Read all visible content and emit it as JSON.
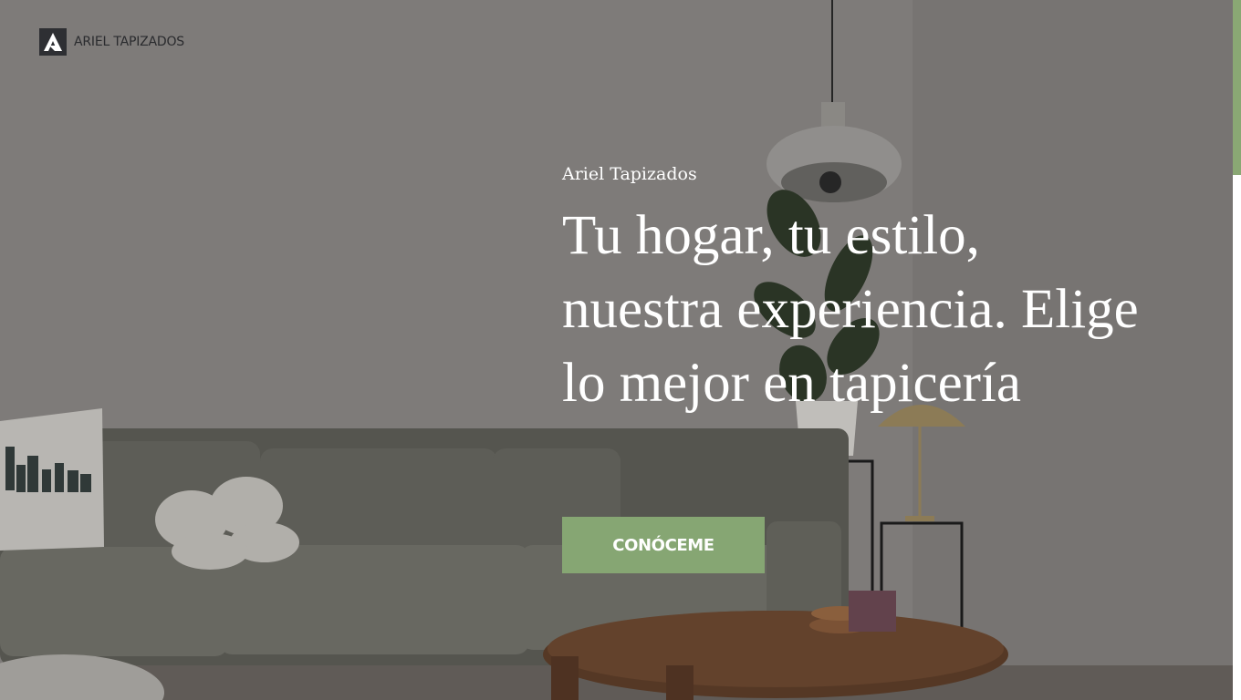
{
  "brand": {
    "name": "ARIEL TAPIZADOS"
  },
  "hero": {
    "eyebrow": "Ariel Tapizados",
    "headline": "Tu hogar, tu estilo, nuestra experiencia. Elige lo mejor en tapicería",
    "cta_label": "CONÓCEME"
  },
  "colors": {
    "accent": "#86a673",
    "scrollbar_thumb": "#8aa874",
    "logo_dark": "#2e2f33"
  },
  "icons": {
    "logo": "ariel-a-logo-icon"
  }
}
